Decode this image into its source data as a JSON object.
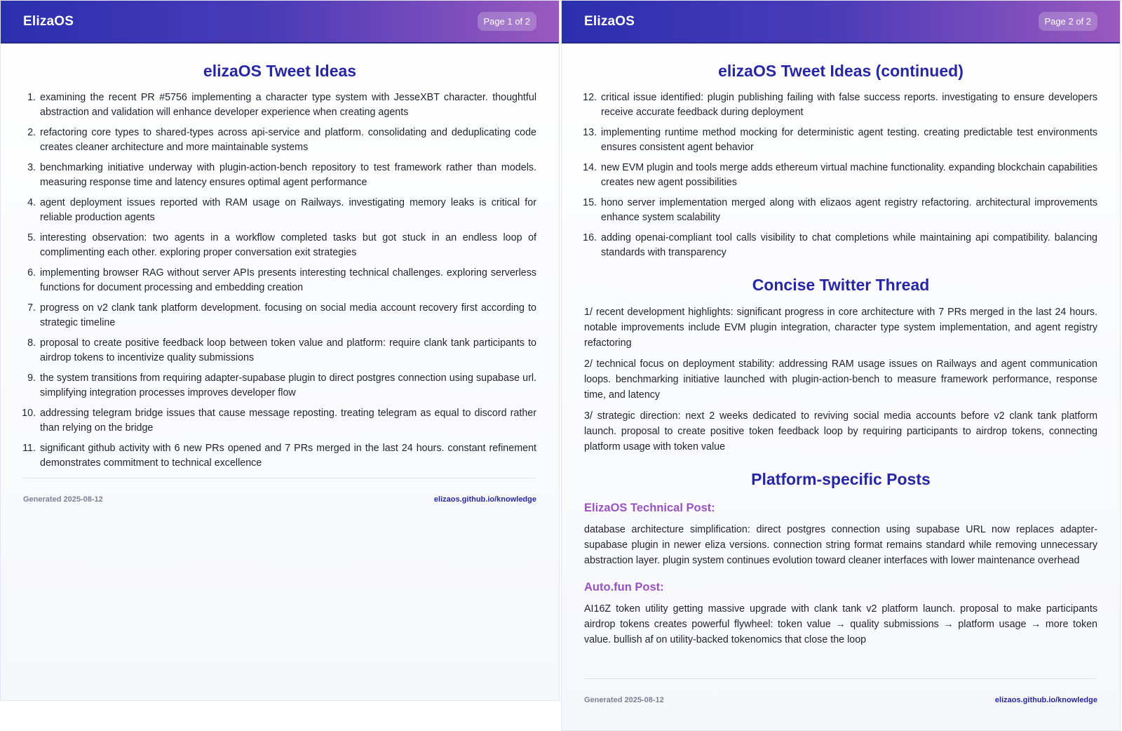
{
  "brand": "ElizaOS",
  "footer": {
    "generated": "Generated 2025-08-12",
    "link": "elizaos.github.io/knowledge"
  },
  "page1": {
    "badge": "Page 1 of 2",
    "title": "elizaOS Tweet Ideas",
    "items": [
      {
        "n": "1.",
        "text": "examining the recent PR #5756 implementing a character type system with JesseXBT character. thoughtful abstraction and validation will enhance developer experience when creating agents"
      },
      {
        "n": "2.",
        "text": "refactoring core types to shared-types across api-service and platform. consolidating and deduplicating code creates cleaner architecture and more maintainable systems"
      },
      {
        "n": "3.",
        "text": "benchmarking initiative underway with plugin-action-bench repository to test framework rather than models. measuring response time and latency ensures optimal agent performance"
      },
      {
        "n": "4.",
        "text": "agent deployment issues reported with RAM usage on Railways. investigating memory leaks is critical for reliable production agents"
      },
      {
        "n": "5.",
        "text": "interesting observation: two agents in a workflow completed tasks but got stuck in an endless loop of complimenting each other. exploring proper conversation exit strategies"
      },
      {
        "n": "6.",
        "text": "implementing browser RAG without server APIs presents interesting technical challenges. exploring serverless functions for document processing and embedding creation"
      },
      {
        "n": "7.",
        "text": "progress on v2 clank tank platform development. focusing on social media account recovery first according to strategic timeline"
      },
      {
        "n": "8.",
        "text": "proposal to create positive feedback loop between token value and platform: require clank tank participants to airdrop tokens to incentivize quality submissions"
      },
      {
        "n": "9.",
        "text": "the system transitions from requiring adapter-supabase plugin to direct postgres connection using supabase url. simplifying integration processes improves developer flow"
      },
      {
        "n": "10.",
        "text": "addressing telegram bridge issues that cause message reposting. treating telegram as equal to discord rather than relying on the bridge"
      },
      {
        "n": "11.",
        "text": "significant github activity with 6 new PRs opened and 7 PRs merged in the last 24 hours. constant refinement demonstrates commitment to technical excellence"
      }
    ]
  },
  "page2": {
    "badge": "Page 2 of 2",
    "title": "elizaOS Tweet Ideas (continued)",
    "items": [
      {
        "n": "12.",
        "text": "critical issue identified: plugin publishing failing with false success reports. investigating to ensure developers receive accurate feedback during deployment"
      },
      {
        "n": "13.",
        "text": "implementing runtime method mocking for deterministic agent testing. creating predictable test environments ensures consistent agent behavior"
      },
      {
        "n": "14.",
        "text": "new EVM plugin and tools merge adds ethereum virtual machine functionality. expanding blockchain capabilities creates new agent possibilities"
      },
      {
        "n": "15.",
        "text": "hono server implementation merged along with elizaos agent registry refactoring. architectural improvements enhance system scalability"
      },
      {
        "n": "16.",
        "text": "adding openai-compliant tool calls visibility to chat completions while maintaining api compatibility. balancing standards with transparency"
      }
    ],
    "thread_title": "Concise Twitter Thread",
    "thread": [
      "1/ recent development highlights: significant progress in core architecture with 7 PRs merged in the last 24 hours. notable improvements include EVM plugin integration, character type system implementation, and agent registry refactoring",
      "2/ technical focus on deployment stability: addressing RAM usage issues on Railways and agent communication loops. benchmarking initiative launched with plugin-action-bench to measure framework performance, response time, and latency",
      "3/ strategic direction: next 2 weeks dedicated to reviving social media accounts before v2 clank tank platform launch. proposal to create positive token feedback loop by requiring participants to airdrop tokens, connecting platform usage with token value"
    ],
    "platform_title": "Platform-specific Posts",
    "tech_heading": "ElizaOS Technical Post:",
    "tech_text": "database architecture simplification: direct postgres connection using supabase URL now replaces adapter-supabase plugin in newer eliza versions. connection string format remains standard while removing unnecessary abstraction layer. plugin system continues evolution toward cleaner interfaces with lower maintenance overhead",
    "autofun_heading": "Auto.fun Post:",
    "autofun_text": "AI16Z token utility getting massive upgrade with clank tank v2 platform launch. proposal to make participants airdrop tokens creates powerful flywheel: token value → quality submissions → platform usage → more token value. bullish af on utility-backed tokenomics that close the loop"
  }
}
